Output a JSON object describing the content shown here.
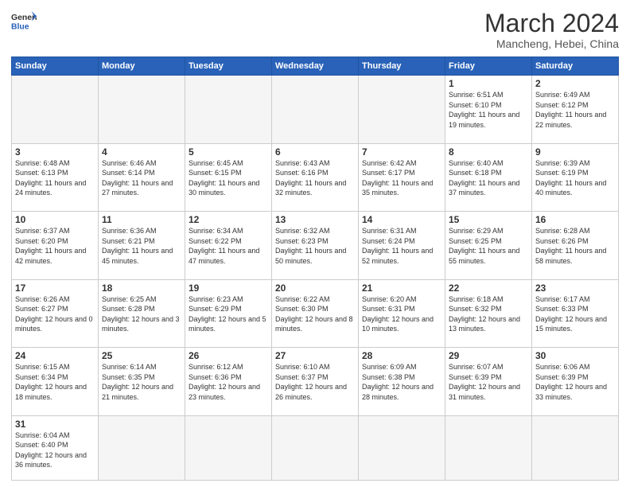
{
  "header": {
    "logo_general": "General",
    "logo_blue": "Blue",
    "title": "March 2024",
    "subtitle": "Mancheng, Hebei, China"
  },
  "weekdays": [
    "Sunday",
    "Monday",
    "Tuesday",
    "Wednesday",
    "Thursday",
    "Friday",
    "Saturday"
  ],
  "weeks": [
    [
      {
        "day": "",
        "info": ""
      },
      {
        "day": "",
        "info": ""
      },
      {
        "day": "",
        "info": ""
      },
      {
        "day": "",
        "info": ""
      },
      {
        "day": "",
        "info": ""
      },
      {
        "day": "1",
        "info": "Sunrise: 6:51 AM\nSunset: 6:10 PM\nDaylight: 11 hours and 19 minutes."
      },
      {
        "day": "2",
        "info": "Sunrise: 6:49 AM\nSunset: 6:12 PM\nDaylight: 11 hours and 22 minutes."
      }
    ],
    [
      {
        "day": "3",
        "info": "Sunrise: 6:48 AM\nSunset: 6:13 PM\nDaylight: 11 hours and 24 minutes."
      },
      {
        "day": "4",
        "info": "Sunrise: 6:46 AM\nSunset: 6:14 PM\nDaylight: 11 hours and 27 minutes."
      },
      {
        "day": "5",
        "info": "Sunrise: 6:45 AM\nSunset: 6:15 PM\nDaylight: 11 hours and 30 minutes."
      },
      {
        "day": "6",
        "info": "Sunrise: 6:43 AM\nSunset: 6:16 PM\nDaylight: 11 hours and 32 minutes."
      },
      {
        "day": "7",
        "info": "Sunrise: 6:42 AM\nSunset: 6:17 PM\nDaylight: 11 hours and 35 minutes."
      },
      {
        "day": "8",
        "info": "Sunrise: 6:40 AM\nSunset: 6:18 PM\nDaylight: 11 hours and 37 minutes."
      },
      {
        "day": "9",
        "info": "Sunrise: 6:39 AM\nSunset: 6:19 PM\nDaylight: 11 hours and 40 minutes."
      }
    ],
    [
      {
        "day": "10",
        "info": "Sunrise: 6:37 AM\nSunset: 6:20 PM\nDaylight: 11 hours and 42 minutes."
      },
      {
        "day": "11",
        "info": "Sunrise: 6:36 AM\nSunset: 6:21 PM\nDaylight: 11 hours and 45 minutes."
      },
      {
        "day": "12",
        "info": "Sunrise: 6:34 AM\nSunset: 6:22 PM\nDaylight: 11 hours and 47 minutes."
      },
      {
        "day": "13",
        "info": "Sunrise: 6:32 AM\nSunset: 6:23 PM\nDaylight: 11 hours and 50 minutes."
      },
      {
        "day": "14",
        "info": "Sunrise: 6:31 AM\nSunset: 6:24 PM\nDaylight: 11 hours and 52 minutes."
      },
      {
        "day": "15",
        "info": "Sunrise: 6:29 AM\nSunset: 6:25 PM\nDaylight: 11 hours and 55 minutes."
      },
      {
        "day": "16",
        "info": "Sunrise: 6:28 AM\nSunset: 6:26 PM\nDaylight: 11 hours and 58 minutes."
      }
    ],
    [
      {
        "day": "17",
        "info": "Sunrise: 6:26 AM\nSunset: 6:27 PM\nDaylight: 12 hours and 0 minutes."
      },
      {
        "day": "18",
        "info": "Sunrise: 6:25 AM\nSunset: 6:28 PM\nDaylight: 12 hours and 3 minutes."
      },
      {
        "day": "19",
        "info": "Sunrise: 6:23 AM\nSunset: 6:29 PM\nDaylight: 12 hours and 5 minutes."
      },
      {
        "day": "20",
        "info": "Sunrise: 6:22 AM\nSunset: 6:30 PM\nDaylight: 12 hours and 8 minutes."
      },
      {
        "day": "21",
        "info": "Sunrise: 6:20 AM\nSunset: 6:31 PM\nDaylight: 12 hours and 10 minutes."
      },
      {
        "day": "22",
        "info": "Sunrise: 6:18 AM\nSunset: 6:32 PM\nDaylight: 12 hours and 13 minutes."
      },
      {
        "day": "23",
        "info": "Sunrise: 6:17 AM\nSunset: 6:33 PM\nDaylight: 12 hours and 15 minutes."
      }
    ],
    [
      {
        "day": "24",
        "info": "Sunrise: 6:15 AM\nSunset: 6:34 PM\nDaylight: 12 hours and 18 minutes."
      },
      {
        "day": "25",
        "info": "Sunrise: 6:14 AM\nSunset: 6:35 PM\nDaylight: 12 hours and 21 minutes."
      },
      {
        "day": "26",
        "info": "Sunrise: 6:12 AM\nSunset: 6:36 PM\nDaylight: 12 hours and 23 minutes."
      },
      {
        "day": "27",
        "info": "Sunrise: 6:10 AM\nSunset: 6:37 PM\nDaylight: 12 hours and 26 minutes."
      },
      {
        "day": "28",
        "info": "Sunrise: 6:09 AM\nSunset: 6:38 PM\nDaylight: 12 hours and 28 minutes."
      },
      {
        "day": "29",
        "info": "Sunrise: 6:07 AM\nSunset: 6:39 PM\nDaylight: 12 hours and 31 minutes."
      },
      {
        "day": "30",
        "info": "Sunrise: 6:06 AM\nSunset: 6:39 PM\nDaylight: 12 hours and 33 minutes."
      }
    ],
    [
      {
        "day": "31",
        "info": "Sunrise: 6:04 AM\nSunset: 6:40 PM\nDaylight: 12 hours and 36 minutes."
      },
      {
        "day": "",
        "info": ""
      },
      {
        "day": "",
        "info": ""
      },
      {
        "day": "",
        "info": ""
      },
      {
        "day": "",
        "info": ""
      },
      {
        "day": "",
        "info": ""
      },
      {
        "day": "",
        "info": ""
      }
    ]
  ]
}
